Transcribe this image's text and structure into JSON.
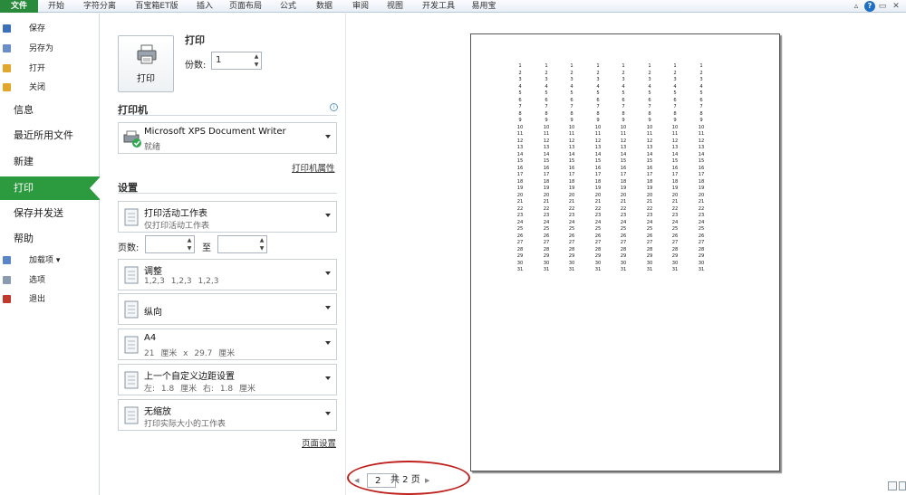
{
  "ribbon": {
    "tabs": [
      {
        "label": "文件",
        "file": true
      },
      {
        "label": "开始"
      },
      {
        "label": "字符分离"
      },
      {
        "label": "百宝箱ET版"
      },
      {
        "label": "插入"
      },
      {
        "label": "页面布局"
      },
      {
        "label": "公式"
      },
      {
        "label": "数据"
      },
      {
        "label": "审阅"
      },
      {
        "label": "视图"
      },
      {
        "label": "开发工具"
      },
      {
        "label": "易用宝"
      }
    ],
    "help": "?"
  },
  "nav": {
    "small_top": [
      {
        "label": "保存",
        "color": "#3b6fb6"
      },
      {
        "label": "另存为",
        "color": "#6a8fc7"
      },
      {
        "label": "打开",
        "color": "#e0a72b"
      },
      {
        "label": "关闭",
        "color": "#e0a72b"
      }
    ],
    "big": [
      {
        "label": "信息",
        "active": false
      },
      {
        "label": "最近所用文件",
        "active": false
      },
      {
        "label": "新建",
        "active": false
      },
      {
        "label": "打印",
        "active": true
      },
      {
        "label": "保存并发送",
        "active": false
      },
      {
        "label": "帮助",
        "active": false
      }
    ],
    "small_bottom": [
      {
        "label": "加载项 ▾",
        "color": "#5b86c6"
      },
      {
        "label": "选项",
        "color": "#8a9bb0"
      },
      {
        "label": "退出",
        "color": "#c0392b"
      }
    ]
  },
  "print": {
    "title": "打印",
    "button_label": "打印",
    "copies_label": "份数:",
    "copies_value": "1"
  },
  "printer": {
    "section": "打印机",
    "name": "Microsoft XPS Document Writer",
    "status": "就绪",
    "properties_link": "打印机属性"
  },
  "settings": {
    "section": "设置",
    "pages_label": "页数:",
    "to_label": "至",
    "dropdowns": [
      {
        "title": "打印活动工作表",
        "sub": "仅打印活动工作表",
        "icon": "sheet-icon"
      },
      {
        "title": "调整",
        "sub": "1,2,3    1,2,3    1,2,3",
        "icon": "collate-icon"
      },
      {
        "title": "纵向",
        "sub": "",
        "icon": "portrait-icon"
      },
      {
        "title": "A4",
        "sub": "21 厘米 x 29.7 厘米",
        "icon": "paper-icon"
      },
      {
        "title": "上一个自定义边距设置",
        "sub": "左: 1.8 厘米    右: 1.8 厘米",
        "icon": "margins-icon"
      },
      {
        "title": "无缩放",
        "sub": "打印实际大小的工作表",
        "icon": "scaling-icon"
      }
    ],
    "page_setup_link": "页面设置"
  },
  "preview": {
    "columns": 8,
    "rows": 31,
    "page_current": "2",
    "page_total": "共 2 页"
  }
}
